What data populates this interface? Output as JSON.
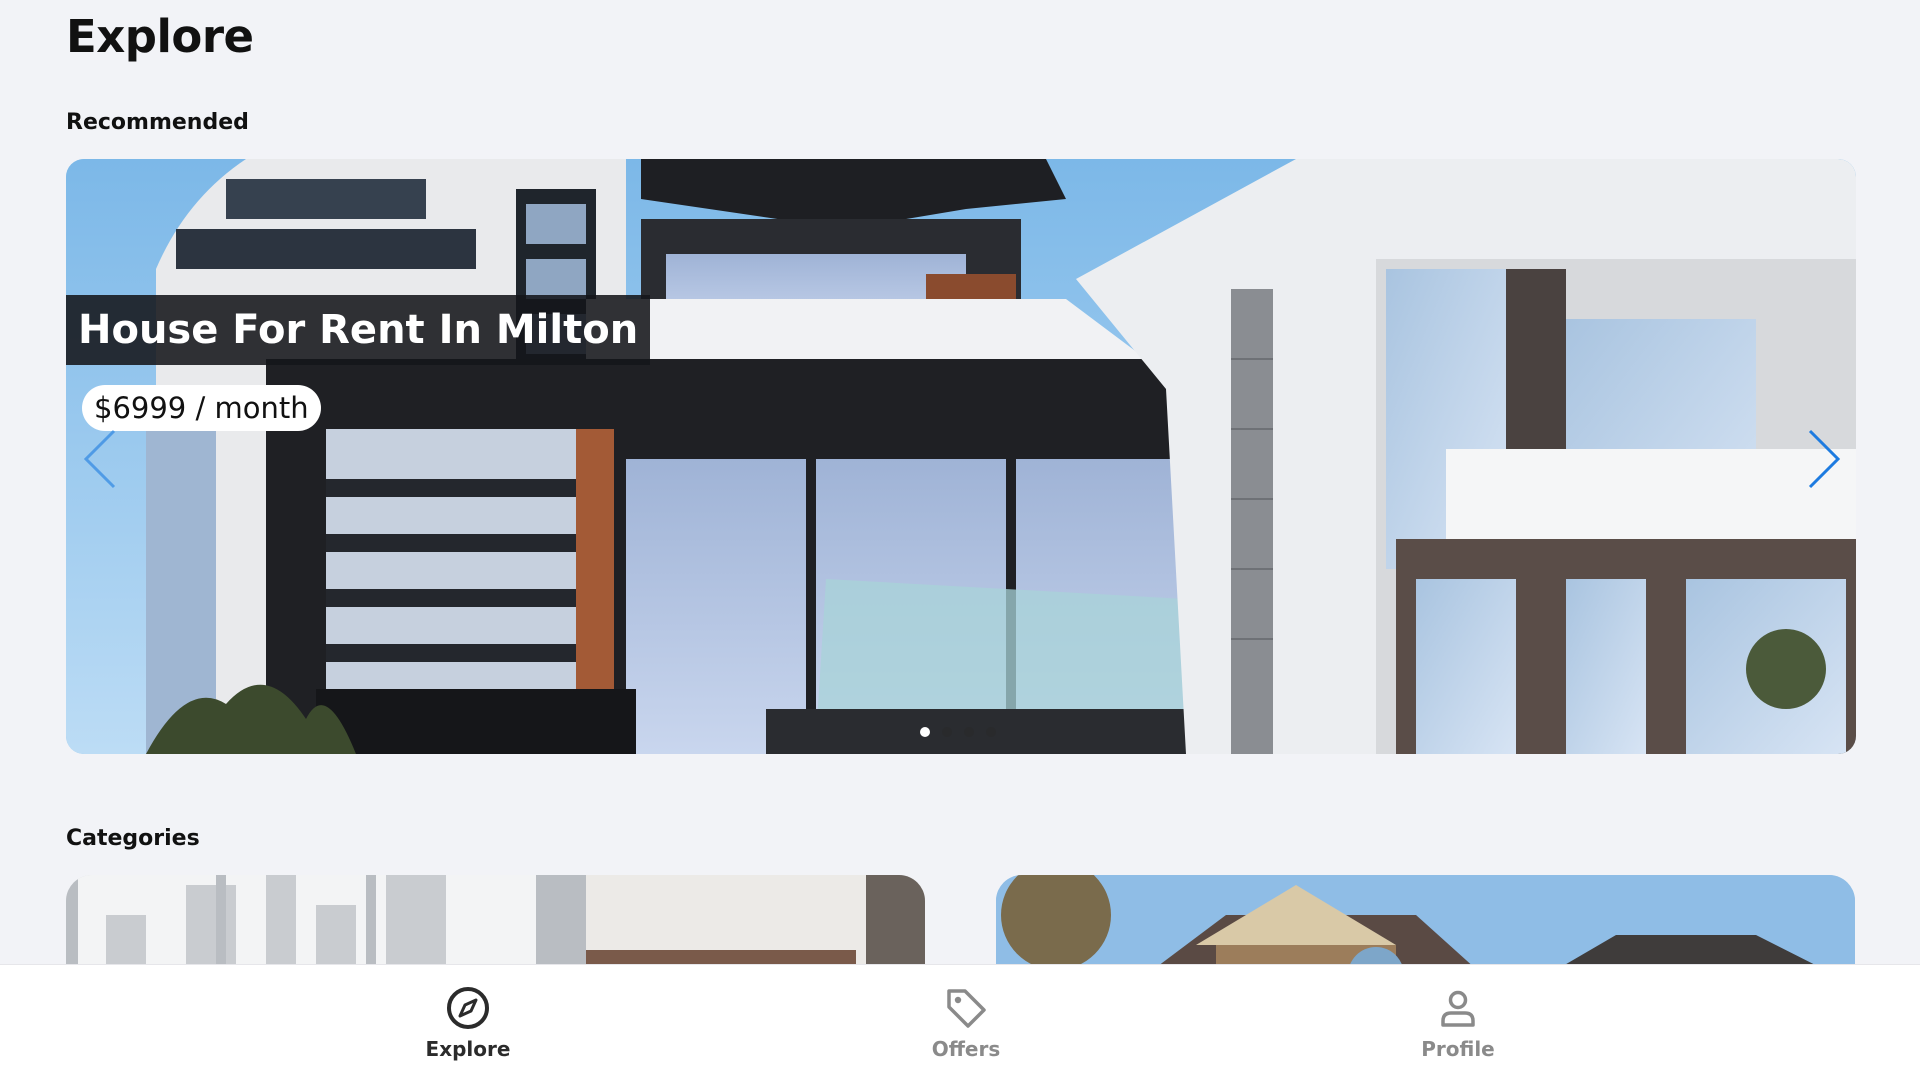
{
  "page": {
    "title": "Explore"
  },
  "recommended": {
    "section_title": "Recommended",
    "listing": {
      "title": "House For Rent In Milton",
      "price": "$6999 / month"
    },
    "carousel": {
      "slide_count": 4,
      "active_index": 0
    }
  },
  "categories": {
    "section_title": "Categories"
  },
  "bottom_nav": {
    "items": [
      {
        "label": "Explore",
        "icon": "compass-icon",
        "active": true
      },
      {
        "label": "Offers",
        "icon": "tag-icon",
        "active": false
      },
      {
        "label": "Profile",
        "icon": "user-icon",
        "active": false
      }
    ]
  },
  "colors": {
    "background": "#f2f3f7",
    "arrow_accent": "#1d7be0",
    "nav_active": "#2b2b2b",
    "nav_inactive": "#8a8a8a"
  }
}
